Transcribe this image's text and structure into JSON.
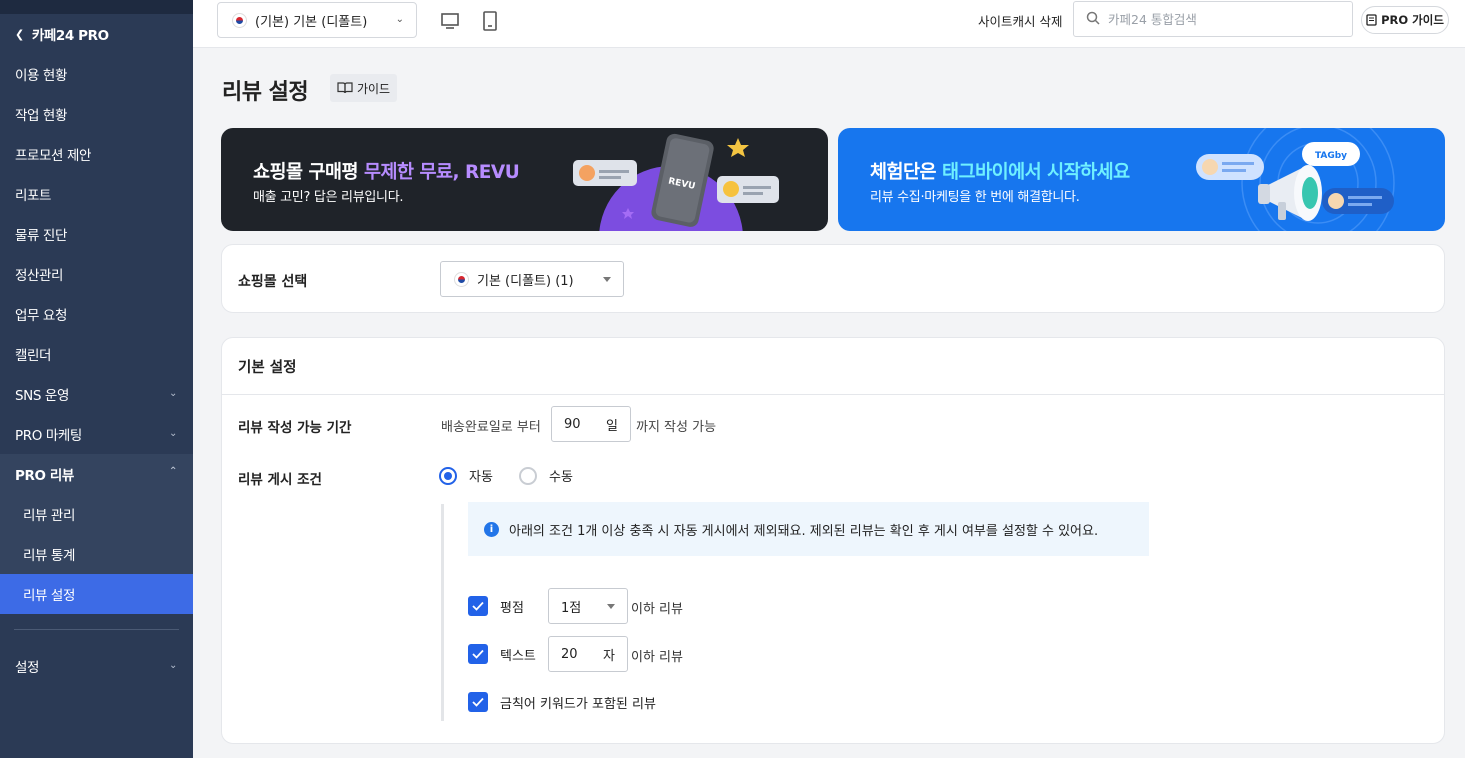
{
  "sidebar": {
    "back_label": "카페24 PRO",
    "items": [
      {
        "label": "이용 현황"
      },
      {
        "label": "작업 현황"
      },
      {
        "label": "프로모션 제안"
      },
      {
        "label": "리포트"
      },
      {
        "label": "물류 진단"
      },
      {
        "label": "정산관리"
      },
      {
        "label": "업무 요청"
      },
      {
        "label": "캘린더"
      },
      {
        "label": "SNS 운영"
      },
      {
        "label": "PRO 마케팅"
      }
    ],
    "group": {
      "label": "PRO 리뷰",
      "children": [
        {
          "label": "리뷰 관리"
        },
        {
          "label": "리뷰 통계"
        },
        {
          "label": "리뷰 설정"
        }
      ]
    },
    "settings_label": "설정"
  },
  "topbar": {
    "mall_select": "(기본) 기본 (디폴트)",
    "cache_delete": "사이트캐시 삭제",
    "search_placeholder": "카페24 통합검색",
    "pro_guide": "PRO 가이드"
  },
  "page": {
    "title": "리뷰 설정",
    "guide_button": "가이드"
  },
  "banners": {
    "left": {
      "title_pre": "쇼핑몰 구매평 ",
      "title_highlight": "무제한 무료, REVU",
      "subtitle": "매출 고민? 답은 리뷰입니다.",
      "phone_text": "REVU"
    },
    "right": {
      "title_pre": "체험단은 ",
      "title_highlight": "태그바이에서 시작하세요",
      "subtitle": "리뷰 수집·마케팅을 한 번에 해결합니다.",
      "badge_text": "TAGby"
    }
  },
  "mall_card": {
    "label": "쇼핑몰 선택",
    "selected": "기본 (디폴트) (1)"
  },
  "basic": {
    "title": "기본 설정",
    "period": {
      "label": "리뷰 작성 가능 기간",
      "prefix": "배송완료일로 부터",
      "value": "90",
      "unit": "일",
      "suffix": "까지 작성 가능"
    },
    "post_condition": {
      "label": "리뷰 게시 조건",
      "options": [
        "자동",
        "수동"
      ],
      "selected": "자동"
    },
    "info": "아래의 조건 1개 이상 충족 시 자동 게시에서 제외돼요. 제외된 리뷰는 확인 후 게시 여부를 설정할 수 있어요.",
    "conditions": {
      "rating": {
        "label": "평점",
        "value": "1점",
        "suffix": "이하 리뷰",
        "checked": true
      },
      "text": {
        "label": "텍스트",
        "value": "20",
        "unit": "자",
        "suffix": "이하 리뷰",
        "checked": true
      },
      "keyword": {
        "label": "금칙어 키워드가 포함된 리뷰",
        "checked": true
      }
    }
  },
  "colors": {
    "sidebar_bg": "#2b3a55",
    "active_item": "#3d6be6",
    "accent_blue": "#2262e8"
  }
}
